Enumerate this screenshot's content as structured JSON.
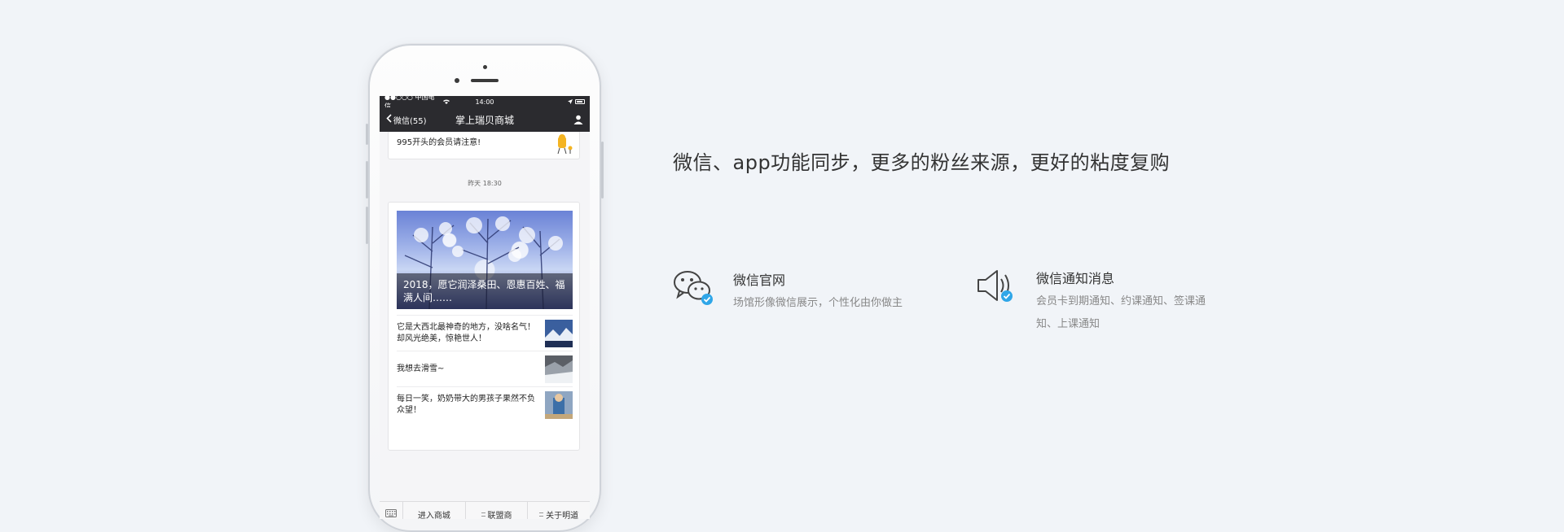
{
  "phone": {
    "status": {
      "carrier": "●●○○○ 中国电信",
      "time": "14:00"
    },
    "nav": {
      "back_label": "微信(55)",
      "title": "掌上瑞贝商城"
    },
    "chat": {
      "top_message": "995开头的会员请注意!",
      "timestamp": "昨天 18:30",
      "hero_caption": "2018，愿它润泽桑田、恩惠百姓、福满人间……",
      "items": [
        {
          "text": "它是大西北最神奇的地方，没啥名气！却风光绝美，惊艳世人！"
        },
        {
          "text": "我想去滑雪~"
        },
        {
          "text": "每日一笑，奶奶带大的男孩子果然不负众望！"
        }
      ]
    },
    "menu": {
      "item1": "进入商城",
      "item2": "联盟商",
      "item3": "关于明道"
    }
  },
  "headline": "微信、app功能同步，更多的粉丝来源，更好的粘度复购",
  "features": [
    {
      "title": "微信官网",
      "desc": "场馆形像微信展示，个性化由你做主"
    },
    {
      "title": "微信通知消息",
      "desc": "会员卡到期通知、约课通知、签课通知、上课通知"
    }
  ],
  "colors": {
    "background": "#f1f4f8",
    "accent_check": "#2fa6e8",
    "nav_dark": "#2b2b2f"
  }
}
